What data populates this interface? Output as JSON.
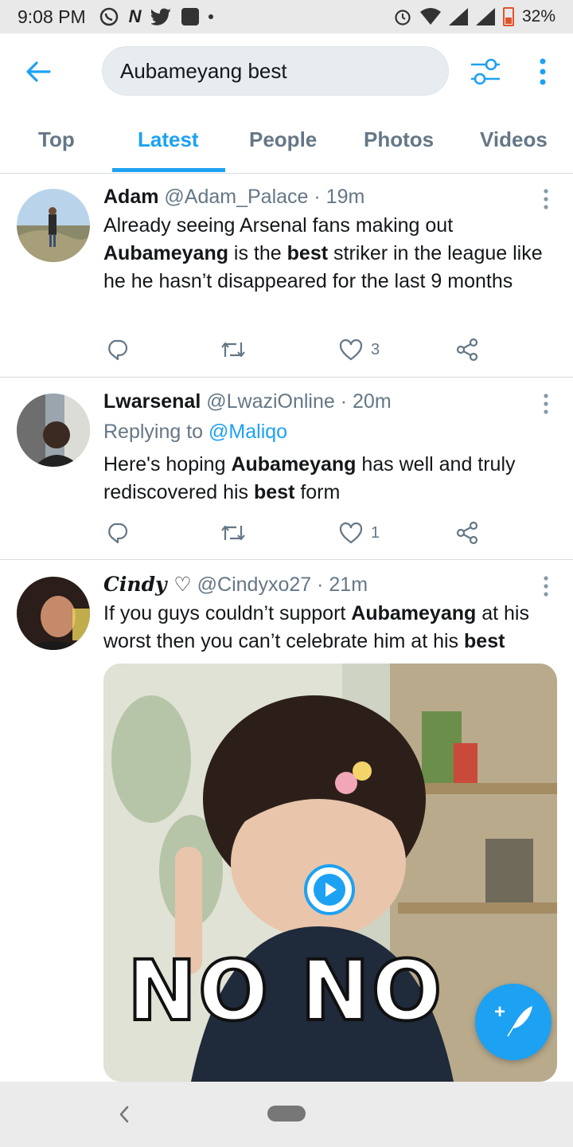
{
  "status_bar": {
    "time": "9:08 PM",
    "battery": "32%",
    "network": "4G"
  },
  "header": {
    "search_value": "Aubameyang best",
    "back_icon": "arrow-left-icon",
    "filter_icon": "sliders-icon",
    "more_icon": "kebab-icon"
  },
  "tabs": [
    {
      "label": "Top",
      "active": false
    },
    {
      "label": "Latest",
      "active": true
    },
    {
      "label": "People",
      "active": false
    },
    {
      "label": "Photos",
      "active": false
    },
    {
      "label": "Videos",
      "active": false
    }
  ],
  "tweets": [
    {
      "name": "Adam",
      "handle": "@Adam_Palace",
      "time": "19m",
      "text_parts": [
        {
          "t": "Already seeing Arsenal fans making out "
        },
        {
          "t": "Aubameyang",
          "b": true
        },
        {
          "t": " is the "
        },
        {
          "t": "best",
          "b": true
        },
        {
          "t": " striker in the league like he he hasn’t disappeared for the last 9 months"
        }
      ],
      "likes": "3"
    },
    {
      "name": "Lwarsenal",
      "handle": "@LwaziOnline",
      "time": "20m",
      "replying_prefix": "Replying to ",
      "replying_to": "@Maliqo",
      "text_parts": [
        {
          "t": "Here's hoping "
        },
        {
          "t": "Aubameyang",
          "b": true
        },
        {
          "t": " has well and truly rediscovered his "
        },
        {
          "t": "best",
          "b": true
        },
        {
          "t": " form"
        }
      ],
      "likes": "1"
    },
    {
      "name": "𝑪𝒊𝒏𝒅𝒚 ♡",
      "handle": "@Cindyxo27",
      "time": "21m",
      "text_parts": [
        {
          "t": "If you guys couldn’t support "
        },
        {
          "t": "Aubameyang",
          "b": true
        },
        {
          "t": " at his worst then you can’t celebrate him at his "
        },
        {
          "t": "best",
          "b": true
        }
      ],
      "media_caption": "NO NO"
    }
  ],
  "colors": {
    "accent": "#1da1f2",
    "muted": "#657786",
    "text": "#14171a"
  }
}
